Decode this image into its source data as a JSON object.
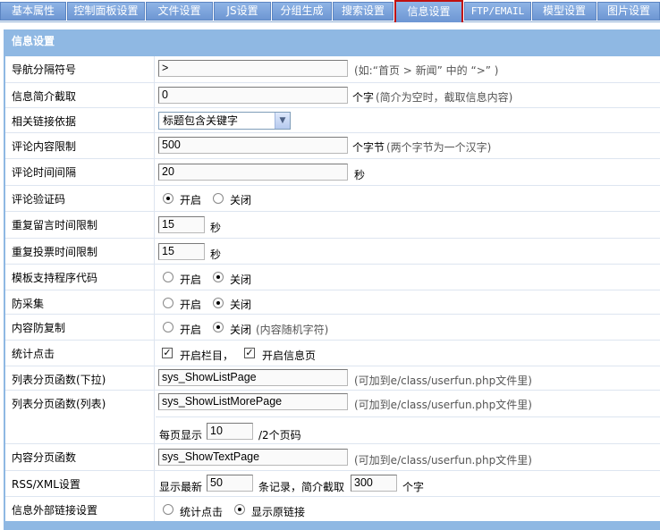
{
  "tabs": [
    {
      "label": "基本属性",
      "active": false
    },
    {
      "label": "控制面板设置",
      "active": false
    },
    {
      "label": "文件设置",
      "active": false
    },
    {
      "label": "JS设置",
      "active": false
    },
    {
      "label": "分组生成",
      "active": false
    },
    {
      "label": "搜索设置",
      "active": false
    },
    {
      "label": "信息设置",
      "active": true
    },
    {
      "label": "FTP/EMAIL",
      "active": false
    },
    {
      "label": "模型设置",
      "active": false
    },
    {
      "label": "图片设置",
      "active": false
    }
  ],
  "panel": {
    "title": "信息设置"
  },
  "rows": {
    "nav_sep": {
      "label": "导航分隔符号",
      "value": ">",
      "hint": "(如:“首页 > 新闻” 中的 “>” )"
    },
    "intro_cut": {
      "label": "信息简介截取",
      "value": "0",
      "unit": "个字",
      "hint": "(简介为空时，截取信息内容)"
    },
    "related": {
      "label": "相关链接依据",
      "selected": "标题包含关键字"
    },
    "comment_limit": {
      "label": "评论内容限制",
      "value": "500",
      "unit": "个字节",
      "hint": "(两个字节为一个汉字)"
    },
    "comment_interval": {
      "label": "评论时间间隔",
      "value": "20",
      "unit": "秒"
    },
    "comment_captcha": {
      "label": "评论验证码",
      "on_label": "开启",
      "off_label": "关闭",
      "value": "on"
    },
    "repeat_msg": {
      "label": "重复留言时间限制",
      "value": "15",
      "unit": "秒"
    },
    "repeat_vote": {
      "label": "重复投票时间限制",
      "value": "15",
      "unit": "秒"
    },
    "tpl_code": {
      "label": "模板支持程序代码",
      "on_label": "开启",
      "off_label": "关闭",
      "value": "off"
    },
    "anti_collect": {
      "label": "防采集",
      "on_label": "开启",
      "off_label": "关闭",
      "value": "off"
    },
    "anti_copy": {
      "label": "内容防复制",
      "on_label": "开启",
      "off_label": "关闭",
      "value": "off",
      "hint": "(内容随机字符)"
    },
    "click_stats": {
      "label": "统计点击",
      "opt1": "开启栏目，",
      "opt2": "开启信息页"
    },
    "list_page_select": {
      "label": "列表分页函数(下拉)",
      "value": "sys_ShowListPage",
      "hint": "(可加到e/class/userfun.php文件里)"
    },
    "list_page_list": {
      "label": "列表分页函数(列表)",
      "value": "sys_ShowListMorePage",
      "hint": "(可加到e/class/userfun.php文件里)",
      "per_page_label": "每页显示",
      "per_page_value": "10",
      "per_page_unit": "/2个页码"
    },
    "content_page": {
      "label": "内容分页函数",
      "value": "sys_ShowTextPage",
      "hint": "(可加到e/class/userfun.php文件里)"
    },
    "rss": {
      "label": "RSS/XML设置",
      "prefix": "显示最新",
      "count": "50",
      "mid": "条记录，简介截取",
      "cut": "300",
      "unit": "个字"
    },
    "ext_link": {
      "label": "信息外部链接设置",
      "opt1": "统计点击",
      "opt2": "显示原链接",
      "value": "opt2"
    }
  }
}
